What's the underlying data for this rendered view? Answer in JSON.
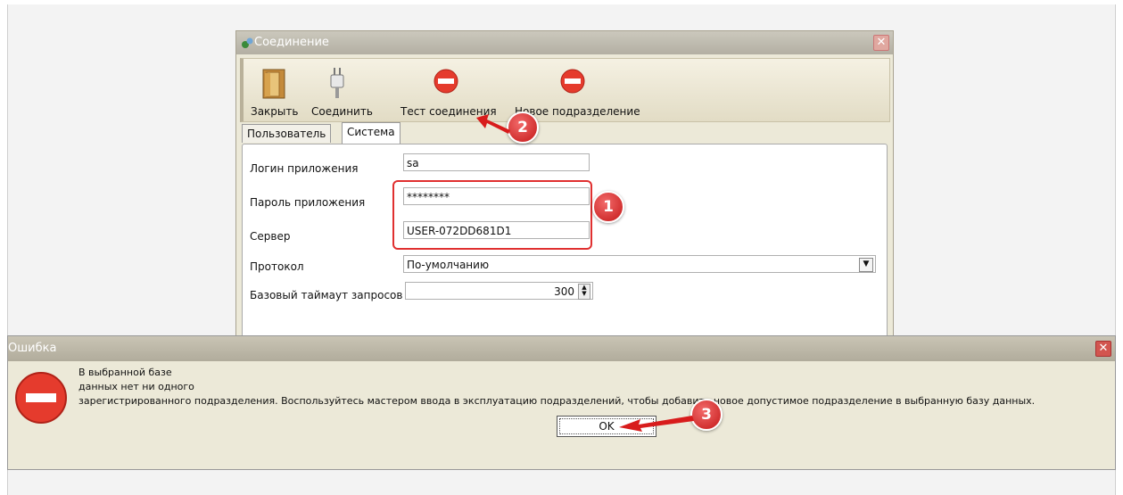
{
  "connection_dialog": {
    "title": "Соединение",
    "close_glyph": "✕",
    "toolbar": [
      {
        "label": "Закрыть",
        "icon": "door-icon"
      },
      {
        "label": "Соединить",
        "icon": "plug-icon"
      },
      {
        "label": "Тест соединения",
        "icon": "stop-icon"
      },
      {
        "label": "Новое подразделение",
        "icon": "stop-icon"
      }
    ],
    "tabs": [
      {
        "label": "Пользователь",
        "active": false
      },
      {
        "label": "Система",
        "active": true
      }
    ],
    "fields": {
      "app_login": {
        "label": "Логин приложения",
        "value": "sa"
      },
      "app_password": {
        "label": "Пароль приложения",
        "value": "********"
      },
      "server": {
        "label": "Сервер",
        "value": "USER-072DD681D1"
      },
      "protocol": {
        "label": "Протокол",
        "value": "По-умолчанию"
      },
      "timeout": {
        "label": "Базовый таймаут запросов",
        "value": "300"
      }
    }
  },
  "error_dialog": {
    "title": "Ошибка",
    "close_glyph": "✕",
    "message_lines": [
      "В выбранной базе",
      "данных нет ни одного",
      "зарегистрированного подразделения. Воспользуйтесь мастером ввода в эксплуатацию подразделений, чтобы добавить новое допустимое подразделение в выбранную базу данных."
    ],
    "ok_label": "OK"
  },
  "annotations": {
    "badge_1": "1",
    "badge_2": "2",
    "badge_3": "3",
    "accent_color": "#e03030"
  }
}
